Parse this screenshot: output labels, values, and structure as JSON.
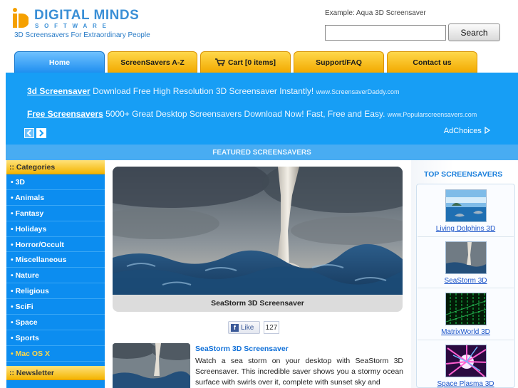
{
  "header": {
    "logo_title": "DIGITAL MINDS",
    "logo_sub": "SOFTWARE",
    "tagline": "3D Screensavers For Extraordinary People",
    "search_example": "Example: Aqua 3D Screensaver",
    "search_value": "",
    "search_button": "Search"
  },
  "nav": {
    "tabs": [
      {
        "label": "Home"
      },
      {
        "label": "ScreenSavers A-Z"
      },
      {
        "label": "Cart [0 items]"
      },
      {
        "label": "Support/FAQ"
      },
      {
        "label": "Contact us"
      }
    ]
  },
  "ads": [
    {
      "link": "3d Screensaver",
      "desc": "Download Free High Resolution 3D Screensaver Instantly!",
      "url": "www.ScreensaverDaddy.com"
    },
    {
      "link": "Free Screensavers",
      "desc": "5000+ Great Desktop Screensavers Download Now! Fast, Free and Easy.",
      "url": "www.Popularscreensavers.com"
    }
  ],
  "adchoices": "AdChoices",
  "featured_label": "FEATURED SCREENSAVERS",
  "sidebar": {
    "categories_title": ":: Categories",
    "items": [
      "• 3D",
      "• Animals",
      "• Fantasy",
      "• Holidays",
      "• Horror/Occult",
      "• Miscellaneous",
      "• Nature",
      "• Religious",
      "• SciFi",
      "• Space",
      "• Sports",
      "• Mac OS X"
    ],
    "newsletter_title": ":: Newsletter"
  },
  "main": {
    "caption": "SeaStorm 3D Screensaver",
    "like_label": "Like",
    "like_count": "127",
    "article_title": "SeaStorm 3D Screensaver",
    "article_text": "Watch a sea storm on your desktop with SeaStorm 3D Screensaver. This incredible saver shows you a stormy ocean surface with swirls over it, complete with sunset sky and"
  },
  "top": {
    "title": "TOP SCREENSAVERS",
    "items": [
      {
        "label": "Living Dolphins 3D"
      },
      {
        "label": "SeaStorm 3D"
      },
      {
        "label": "MatrixWorld 3D"
      },
      {
        "label": "Space Plasma 3D"
      }
    ]
  },
  "colors": {
    "brand_blue": "#179ef5",
    "tab_yellow": "#f2a900",
    "sidebar_blue": "#0c8df0",
    "link_blue": "#1070d8"
  }
}
